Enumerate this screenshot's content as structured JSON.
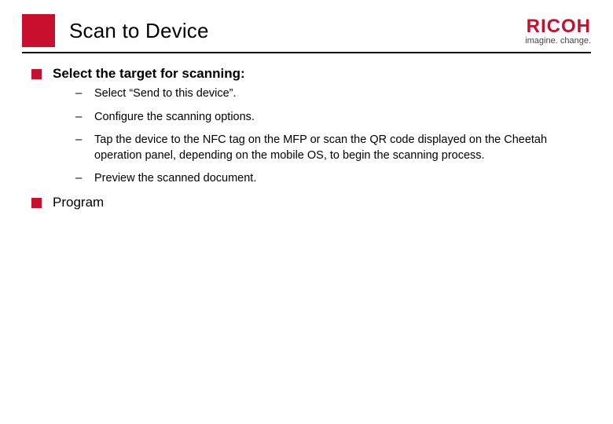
{
  "header": {
    "title": "Scan to Device",
    "logo": {
      "brand": "RICOH",
      "tagline_prefix": "imagine",
      "tagline_suffix": "change",
      "dot": "."
    }
  },
  "content": {
    "section1": {
      "heading": "Select the target for scanning:",
      "items": [
        "Select “Send to this device”.",
        "Configure the scanning options.",
        "Tap the device to the NFC tag on the MFP or scan the QR code displayed on the Cheetah operation panel, depending on the mobile OS, to begin the scanning process.",
        "Preview the scanned document."
      ]
    },
    "section2": {
      "heading": "Program"
    }
  }
}
